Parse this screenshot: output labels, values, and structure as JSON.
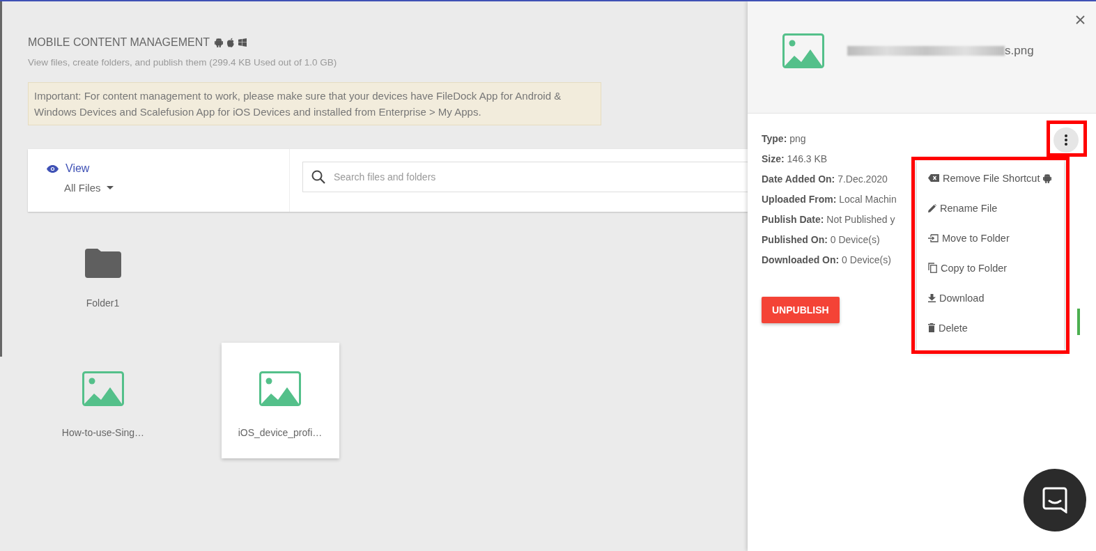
{
  "header": {
    "title": "MOBILE CONTENT MANAGEMENT",
    "subtitle": "View files, create folders, and publish them (299.4 KB Used out of 1.0 GB)",
    "notice": "Important: For content management to work, please make sure that your devices have FileDock App for Android & Windows Devices and Scalefusion App for iOS Devices and installed from Enterprise > My Apps."
  },
  "view": {
    "label": "View",
    "filter": "All Files"
  },
  "search": {
    "placeholder": "Search files and folders"
  },
  "items": [
    {
      "kind": "folder",
      "name": "Folder1",
      "selected": false
    },
    {
      "kind": "image",
      "name": "How-to-use-Sing…",
      "selected": false
    },
    {
      "kind": "image",
      "name": "iOS_device_profi…",
      "selected": true
    }
  ],
  "panel": {
    "file_name": "s.png",
    "details": [
      {
        "label": "Type:",
        "value": "png"
      },
      {
        "label": "Size:",
        "value": "146.3 KB"
      },
      {
        "label": "Date Added On:",
        "value": "7.Dec.2020"
      },
      {
        "label": "Uploaded From:",
        "value": "Local Machin"
      },
      {
        "label": "Publish Date:",
        "value": "Not Published y"
      },
      {
        "label": "Published On:",
        "value": "0 Device(s)"
      },
      {
        "label": "Downloaded On:",
        "value": "0 Device(s)"
      }
    ],
    "primary_button": "UNPUBLISH",
    "more_highlighted": true
  },
  "menu": {
    "highlighted": true,
    "items": [
      {
        "kind": "remove",
        "label": "Remove File Shortcut"
      },
      {
        "kind": "rename",
        "label": "Rename File"
      },
      {
        "kind": "move",
        "label": "Move to Folder"
      },
      {
        "kind": "copy",
        "label": "Copy to Folder"
      },
      {
        "kind": "download",
        "label": "Download"
      },
      {
        "kind": "delete",
        "label": "Delete"
      }
    ]
  }
}
